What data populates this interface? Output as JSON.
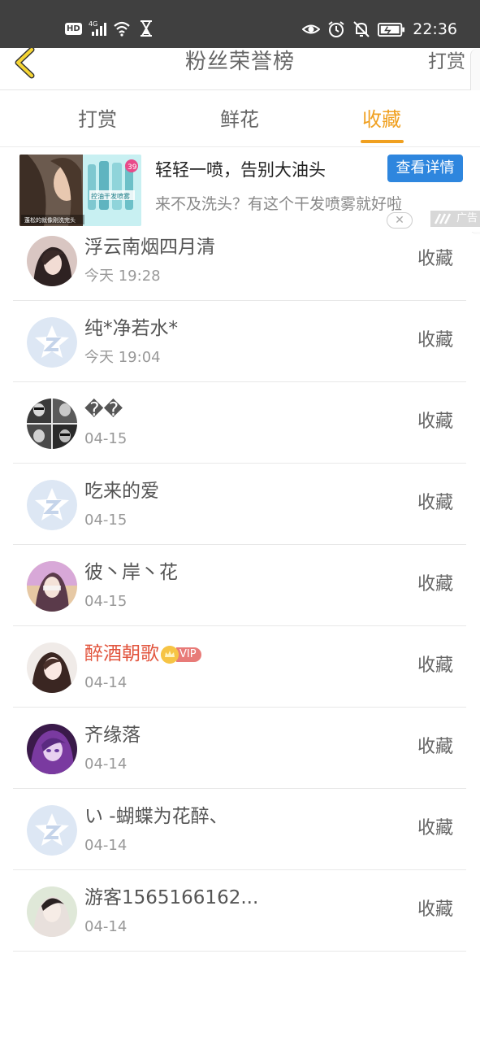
{
  "status_bar": {
    "left_icons": [
      "hd-icon",
      "signal-4g-icon",
      "wifi-icon",
      "hourglass-icon"
    ],
    "hd_label": "HD",
    "right_icons": [
      "eye-icon",
      "alarm-icon",
      "mute-icon",
      "battery-icon"
    ],
    "time": "22:36"
  },
  "header": {
    "back_icon": "chevron-left-icon",
    "title": "粉丝荣誉榜",
    "action_label": "打赏"
  },
  "tabs": [
    {
      "label": "打赏",
      "active": false
    },
    {
      "label": "鲜花",
      "active": false
    },
    {
      "label": "收藏",
      "active": true
    }
  ],
  "ad": {
    "title": "轻轻一喷，告别大油头",
    "subtitle": "来不及洗头？有这个干发喷雾就好啦",
    "button_label": "查看详情",
    "tag_label": "广告",
    "close_icon": "close-icon",
    "image_caption": "蓬松的就像刚洗完头",
    "product_label": "控油干发喷雾",
    "price_badge": "39"
  },
  "list": [
    {
      "name": "浮云南烟四月清",
      "time": "今天 19:28",
      "action": "收藏",
      "avatar": "photo",
      "vip": false
    },
    {
      "name": "纯*净若水*",
      "time": "今天 19:04",
      "action": "收藏",
      "avatar": "default",
      "vip": false
    },
    {
      "name": "��",
      "time": "04-15",
      "action": "收藏",
      "avatar": "photo",
      "vip": false
    },
    {
      "name": "吃来的爱",
      "time": "04-15",
      "action": "收藏",
      "avatar": "default",
      "vip": false
    },
    {
      "name": "彼丶岸丶花",
      "time": "04-15",
      "action": "收藏",
      "avatar": "photo",
      "vip": false
    },
    {
      "name": "醉酒朝歌",
      "time": "04-14",
      "action": "收藏",
      "avatar": "photo",
      "vip": true,
      "vip_label": "VIP"
    },
    {
      "name": "齐缘落",
      "time": "04-14",
      "action": "收藏",
      "avatar": "photo",
      "vip": false
    },
    {
      "name": "い -蝴蝶为花醉、",
      "time": "04-14",
      "action": "收藏",
      "avatar": "default",
      "vip": false
    },
    {
      "name": "游客1565166162...",
      "time": "04-14",
      "action": "收藏",
      "avatar": "photo",
      "vip": false
    }
  ],
  "colors": {
    "accent": "#f0a020",
    "vip_name": "#e2553e",
    "ad_button": "#2e86de",
    "status_bar": "#404040"
  }
}
